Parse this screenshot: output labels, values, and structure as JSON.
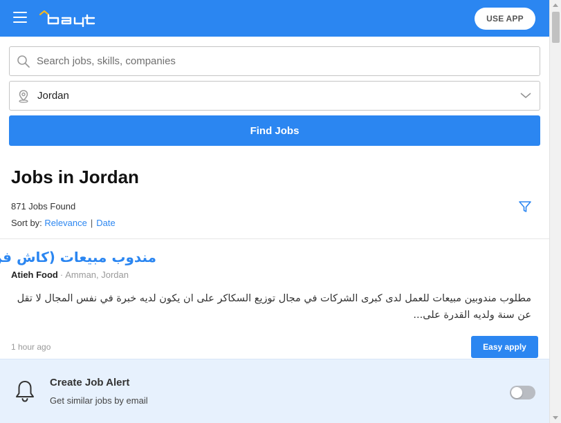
{
  "header": {
    "logo_text": "bayt",
    "use_app_label": "USE APP",
    "brand_color": "#2b86f1"
  },
  "search": {
    "placeholder": "Search jobs, skills, companies",
    "location_value": "Jordan",
    "find_label": "Find Jobs"
  },
  "results": {
    "title": "Jobs in Jordan",
    "count_label": "871 Jobs Found",
    "sort_label": "Sort by:",
    "sort_options": [
      "Relevance",
      "Date"
    ]
  },
  "jobs": [
    {
      "title": "مندوب مبيعات (كاش فن )",
      "company": "Atieh Food",
      "separator": "·",
      "location": "Amman, Jordan",
      "description": "مطلوب مندوبين مبيعات للعمل لدى كبرى الشركات في مجال توزيع السكاكر على ان يكون لديه خبرة في نفس المجال لا تقل عن سنة ولديه القدرة على...",
      "posted": "1 hour ago",
      "apply_label": "Easy apply"
    }
  ],
  "alert": {
    "title": "Create Job Alert",
    "subtitle": "Get similar jobs by email",
    "toggle_on": false
  },
  "icons": {
    "menu": "menu-icon",
    "search": "search-icon",
    "location": "location-pin-icon",
    "dropdown": "chevron-down-icon",
    "filter": "filter-icon",
    "bell": "bell-icon"
  }
}
